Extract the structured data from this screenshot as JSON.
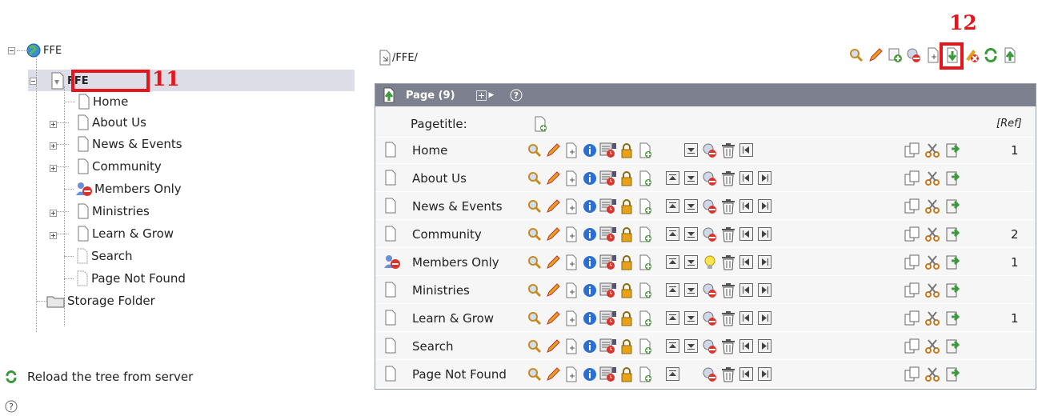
{
  "tree": {
    "root_label": "FFE",
    "site_label": "FFE",
    "items": [
      {
        "label": "Home"
      },
      {
        "label": "About Us"
      },
      {
        "label": "News & Events"
      },
      {
        "label": "Community"
      },
      {
        "label": "Members Only"
      },
      {
        "label": "Ministries"
      },
      {
        "label": "Learn & Grow"
      },
      {
        "label": "Search"
      },
      {
        "label": "Page Not Found"
      }
    ],
    "storage_folder_label": "Storage Folder",
    "reload_label": "Reload the tree from server"
  },
  "annotations": {
    "left_number": "11",
    "right_number": "12",
    "color": "#e8141c"
  },
  "path": {
    "label": "/FFE/"
  },
  "panel": {
    "header_label": "Page (9)",
    "pagetitle_label": "Pagetitle:",
    "ref_label": "[Ref]",
    "header_color": "#7d808e",
    "rows": [
      {
        "title": "Home",
        "ref": "1"
      },
      {
        "title": "About Us",
        "ref": ""
      },
      {
        "title": "News & Events",
        "ref": ""
      },
      {
        "title": "Community",
        "ref": "2"
      },
      {
        "title": "Members Only",
        "ref": "1"
      },
      {
        "title": "Ministries",
        "ref": ""
      },
      {
        "title": "Learn & Grow",
        "ref": "1"
      },
      {
        "title": "Search",
        "ref": ""
      },
      {
        "title": "Page Not Found",
        "ref": ""
      }
    ]
  },
  "icons": {
    "globe": "globe-icon",
    "page": "page-icon",
    "folder": "folder-icon",
    "reload": "reload-icon",
    "help": "help-icon",
    "search": "search-icon",
    "edit": "pencil-icon",
    "lock": "lock-icon",
    "delete": "trash-icon"
  }
}
